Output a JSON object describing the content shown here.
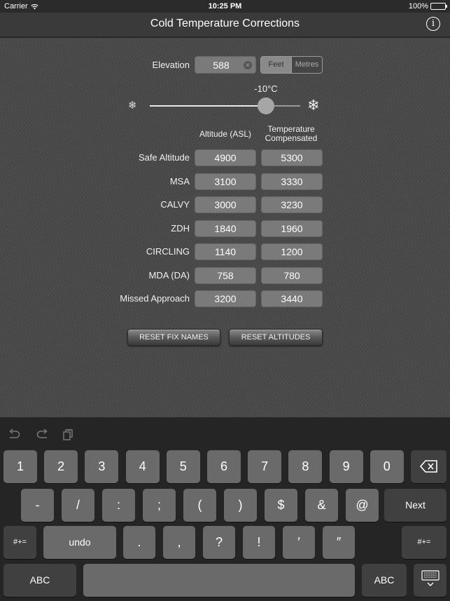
{
  "status_bar": {
    "carrier": "Carrier",
    "time": "10:25 PM",
    "battery": "100%",
    "battery_level": 1.0
  },
  "nav": {
    "title": "Cold Temperature Corrections",
    "info_icon": "info-icon"
  },
  "elevation": {
    "label": "Elevation",
    "value": "588",
    "units": [
      {
        "label": "Feet",
        "selected": true
      },
      {
        "label": "Metres",
        "selected": false
      }
    ]
  },
  "temperature": {
    "value_label": "-10°C",
    "slider_fraction": 0.77,
    "left_icon": "snowflake-small-icon",
    "right_icon": "snowflake-large-icon"
  },
  "table": {
    "col_altitude": "Altitude (ASL)",
    "col_compensated": "Temperature Compensated",
    "rows": [
      {
        "label": "Safe Altitude",
        "altitude": "4900",
        "compensated": "5300"
      },
      {
        "label": "MSA",
        "altitude": "3100",
        "compensated": "3330"
      },
      {
        "label": "CALVY",
        "altitude": "3000",
        "compensated": "3230"
      },
      {
        "label": "ZDH",
        "altitude": "1840",
        "compensated": "1960"
      },
      {
        "label": "CIRCLING",
        "altitude": "1140",
        "compensated": "1200"
      },
      {
        "label": "MDA (DA)",
        "altitude": "758",
        "compensated": "780"
      },
      {
        "label": "Missed Approach",
        "altitude": "3200",
        "compensated": "3440"
      }
    ]
  },
  "buttons": {
    "reset_fix_names": "RESET FIX NAMES",
    "reset_altitudes": "RESET ALTITUDES"
  },
  "keyboard": {
    "toolbar": [
      "undo-icon",
      "redo-icon",
      "paste-icon"
    ],
    "row1": [
      "1",
      "2",
      "3",
      "4",
      "5",
      "6",
      "7",
      "8",
      "9",
      "0"
    ],
    "row2": [
      "-",
      "/",
      ":",
      ";",
      "(",
      ")",
      "$",
      "&",
      "@"
    ],
    "next": "Next",
    "row3_left": "#+=",
    "undo": "undo",
    "row3": [
      ".",
      ",",
      "?",
      "!",
      "′",
      "″"
    ],
    "row3_right": "#+=",
    "abc_left": "ABC",
    "abc_right": "ABC"
  }
}
